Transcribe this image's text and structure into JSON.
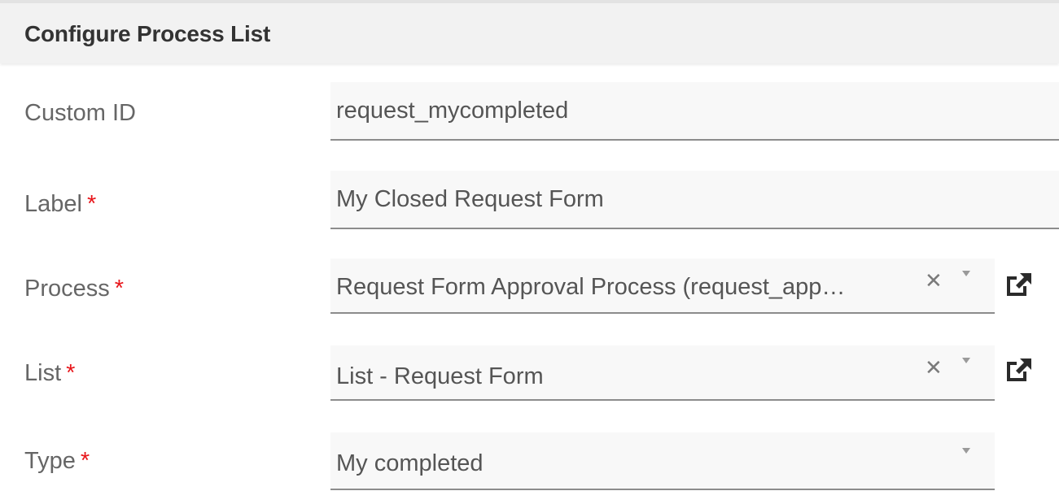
{
  "header": {
    "title": "Configure Process List"
  },
  "fields": {
    "custom_id": {
      "label": "Custom ID",
      "value": "request_mycompleted"
    },
    "label": {
      "label": "Label",
      "required_mark": "*",
      "value": "My Closed Request Form"
    },
    "process": {
      "label": "Process",
      "required_mark": "*",
      "value": "Request Form Approval Process (request_app…",
      "clear_glyph": "✕",
      "open_icon": "external-link-icon"
    },
    "list": {
      "label": "List",
      "required_mark": "*",
      "value": "List - Request Form",
      "clear_glyph": "✕",
      "open_icon": "external-link-icon"
    },
    "type": {
      "label": "Type",
      "required_mark": "*",
      "value": "My completed"
    }
  },
  "colors": {
    "required": "#e8161b",
    "header_bg": "#f2f2f2",
    "input_bg": "#f8f8f8"
  }
}
